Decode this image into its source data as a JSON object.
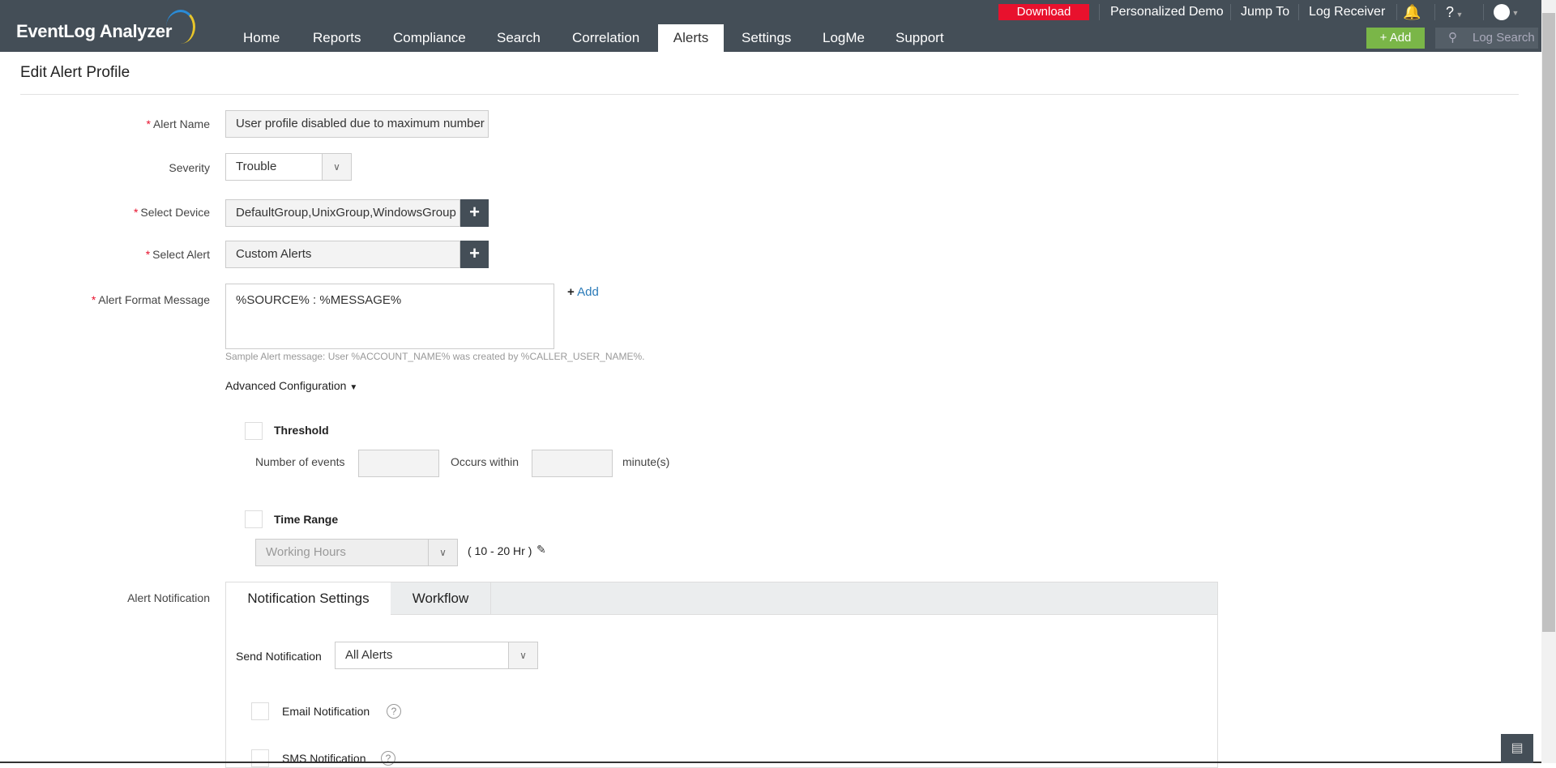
{
  "app": {
    "logo": "EventLog Analyzer"
  },
  "nav": [
    "Home",
    "Reports",
    "Compliance",
    "Search",
    "Correlation",
    "Alerts",
    "Settings",
    "LogMe",
    "Support"
  ],
  "nav_active": "Alerts",
  "topbar": {
    "download": "Download",
    "personalized_demo": "Personalized Demo",
    "jump_to": "Jump To",
    "log_receiver": "Log Receiver",
    "help": "?",
    "add": "Add",
    "search_placeholder": "Log Search"
  },
  "page": {
    "title": "Edit Alert Profile"
  },
  "form": {
    "alert_name_label": "Alert Name",
    "alert_name": "User profile disabled due to maximum number",
    "severity_label": "Severity",
    "severity": "Trouble",
    "device_label": "Select Device",
    "device": "DefaultGroup,UnixGroup,WindowsGroup",
    "alert_label": "Select Alert",
    "alert": "Custom Alerts",
    "format_label": "Alert Format Message",
    "format": "%SOURCE% : %MESSAGE%",
    "format_add": "Add",
    "sample": "Sample Alert message: User %ACCOUNT_NAME% was created by %CALLER_USER_NAME%.",
    "advanced": "Advanced Configuration",
    "threshold": "Threshold",
    "num_events": "Number of events",
    "occurs_within": "Occurs within",
    "minutes": "minute(s)",
    "time_range": "Time Range",
    "time_range_value": "Working Hours",
    "time_range_hours": "( 10 - 20 Hr )",
    "notification_label": "Alert Notification",
    "tabs": [
      "Notification Settings",
      "Workflow"
    ],
    "send_notification_label": "Send Notification",
    "send_notification": "All Alerts",
    "email": "Email Notification",
    "sms": "SMS Notification"
  },
  "colors": {
    "header": "#444e57",
    "download": "#e8112d",
    "add": "#7ab648",
    "link": "#2a7ab8"
  }
}
